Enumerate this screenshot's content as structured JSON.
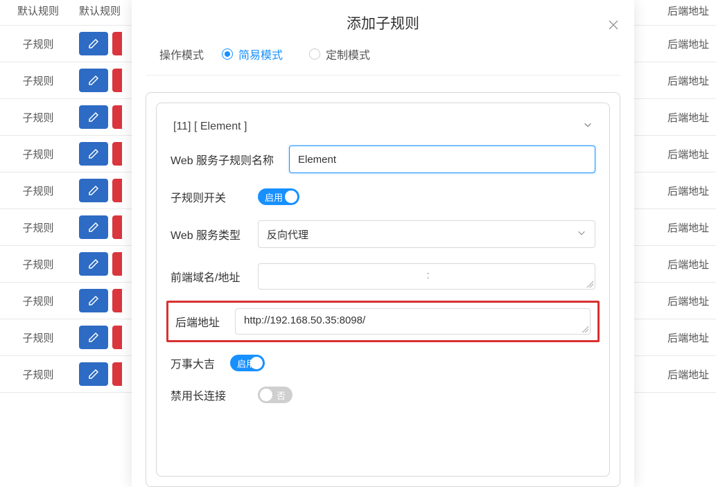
{
  "background": {
    "header_col1": "默认规则",
    "header_col2": "默认规则",
    "row_label": "子规则",
    "col3_label": "后端地址",
    "row_count": 10
  },
  "modal": {
    "title": "添加子规则",
    "mode_label": "操作模式",
    "mode_simple": "简易模式",
    "mode_custom": "定制模式",
    "collapse_title": "[11] [ Element ]",
    "fields": {
      "name_label": "Web 服务子规则名称",
      "name_value": "Element",
      "switch_label": "子规则开关",
      "switch_on": "启用",
      "type_label": "Web 服务类型",
      "type_value": "反向代理",
      "front_label": "前端域名/地址",
      "front_value": "",
      "back_label": "后端地址",
      "back_value": "http://192.168.50.35:8098/",
      "lucky_label": "万事大吉",
      "lucky_on": "启用",
      "keepalive_label": "禁用长连接",
      "keepalive_off": "否"
    }
  }
}
